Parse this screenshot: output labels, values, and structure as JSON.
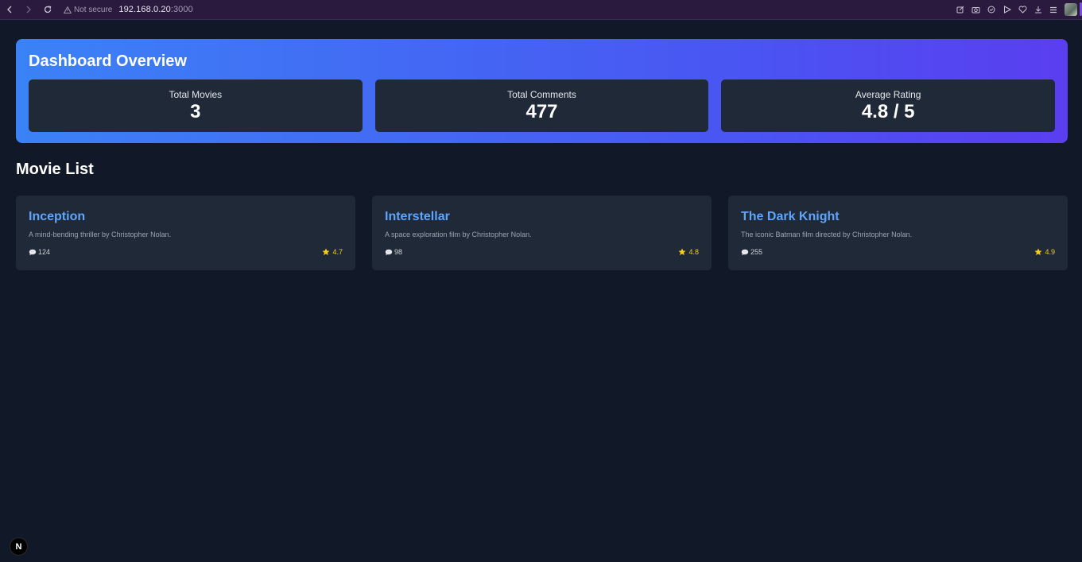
{
  "browser": {
    "security_label": "Not secure",
    "url_host": "192.168.0.20",
    "url_port": ":3000"
  },
  "dashboard": {
    "title": "Dashboard Overview",
    "stats": [
      {
        "label": "Total Movies",
        "value": "3"
      },
      {
        "label": "Total Comments",
        "value": "477"
      },
      {
        "label": "Average Rating",
        "value": "4.8 / 5"
      }
    ]
  },
  "movie_list": {
    "title": "Movie List",
    "movies": [
      {
        "title": "Inception",
        "description": "A mind-bending thriller by Christopher Nolan.",
        "comments": "124",
        "rating": "4.7"
      },
      {
        "title": "Interstellar",
        "description": "A space exploration film by Christopher Nolan.",
        "comments": "98",
        "rating": "4.8"
      },
      {
        "title": "The Dark Knight",
        "description": "The iconic Batman film directed by Christopher Nolan.",
        "comments": "255",
        "rating": "4.9"
      }
    ]
  },
  "dev_badge": {
    "label": "N"
  },
  "colors": {
    "page_bg": "#111827",
    "card_bg": "#1f2937",
    "accent_blue": "#60a5fa",
    "star": "#facc15",
    "gradient_start": "#3b82f6",
    "gradient_end": "#5a3ef0"
  }
}
